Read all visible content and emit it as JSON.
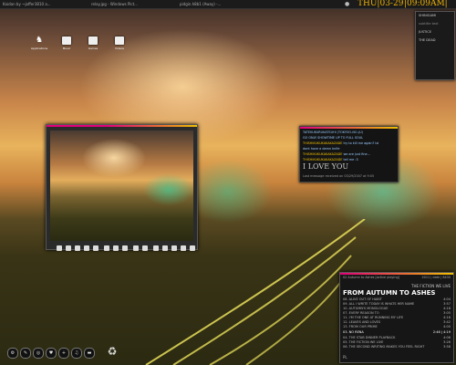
{
  "topbar": {
    "tasks": [
      "Kaidan by ~joffer3810 a...",
      "relay.jpg - Windows Pict...",
      "pidgin.h8b1 (Away) -..."
    ],
    "clock_date": "THU|03-29",
    "clock_time": "|09:09AM|",
    "tray_icon": "pin-icon"
  },
  "desktop_icons": [
    {
      "label": "Applications",
      "icon": "wolf-icon"
    },
    {
      "label": "Music",
      "icon": "music-app-icon"
    },
    {
      "label": "Games",
      "icon": "games-icon"
    },
    {
      "label": "Videos",
      "icon": "videos-icon"
    }
  ],
  "side_panel": {
    "items": [
      "SHINIGAMI",
      "JUSTICE",
      "THE DEAD"
    ],
    "subitems": [
      "subtitle text"
    ]
  },
  "preview_window": {
    "control_count": 15
  },
  "chat_window": {
    "lines": [
      {
        "who": "",
        "text": "TATEKUKURUKATSUHI (TOKYOO-NO-JU)"
      },
      {
        "who": "",
        "text": "GO ONLY SHOWTIME UP TO FULL SOUL"
      },
      {
        "who": "THISHIKUKUKAKAKAZADE",
        "text": "try to kill me again? lol"
      },
      {
        "who": "",
        "text": "dont have a damn knife"
      },
      {
        "who": "THISHIKUKUKAKAKAZADE",
        "text": "we are just fine..."
      },
      {
        "who": "THISHIKUKUKAKAKAZADE",
        "text": "tell me :3"
      }
    ],
    "big_text": "I LOVE YOU",
    "status": "Last message received on 03/29/2007 at 9:05"
  },
  "player": {
    "header_left": "02 Autumn to Ashes [active playing]",
    "header_right": "2011 | date | 8430",
    "artist": "THE FICTION WE LIVE",
    "album": "FROM AUTUMN TO ASHES",
    "tracks": [
      {
        "title": "08. ALIVE OUT OF HABIT",
        "dur": "4:04"
      },
      {
        "title": "09. ALL I WRITE TODAY IS WHATS HER NAME",
        "dur": "3:57"
      },
      {
        "title": "10. AUTUMN'S MONOLOGUE",
        "dur": "4:18"
      },
      {
        "title": "07. EVERY REASON TO",
        "dur": "3:05"
      },
      {
        "title": "11. I'M THE ONE AT RUNNING MY LIFE",
        "dur": "4:16"
      },
      {
        "title": "12. LEAVES AND LOVES",
        "dur": "3:42"
      },
      {
        "title": "13. FROM OUR PRIME",
        "dur": "4:00"
      },
      {
        "title": "03. NO RENA",
        "dur": "4:19"
      },
      {
        "title": "04. THE STAB DINNER PLAYBACK",
        "dur": "4:06"
      },
      {
        "title": "05. THE FICTION WE LIVE",
        "dur": "3:26"
      },
      {
        "title": "06. THE SECOND WRITING MAKES YOU FEEL RIGHT",
        "dur": "3:58"
      }
    ],
    "now_playing_index": 7,
    "now_playing_time": "2:46",
    "footer": "PL"
  },
  "dock": {
    "icons": [
      "settings-icon",
      "edit-icon",
      "globe-icon",
      "heart-icon",
      "plus-icon",
      "music-icon",
      "folder-icon",
      "recycle-icon"
    ]
  },
  "colors": {
    "accent_magenta": "#e2007a",
    "accent_yellow": "#f0c000",
    "clock": "#f0b400"
  }
}
